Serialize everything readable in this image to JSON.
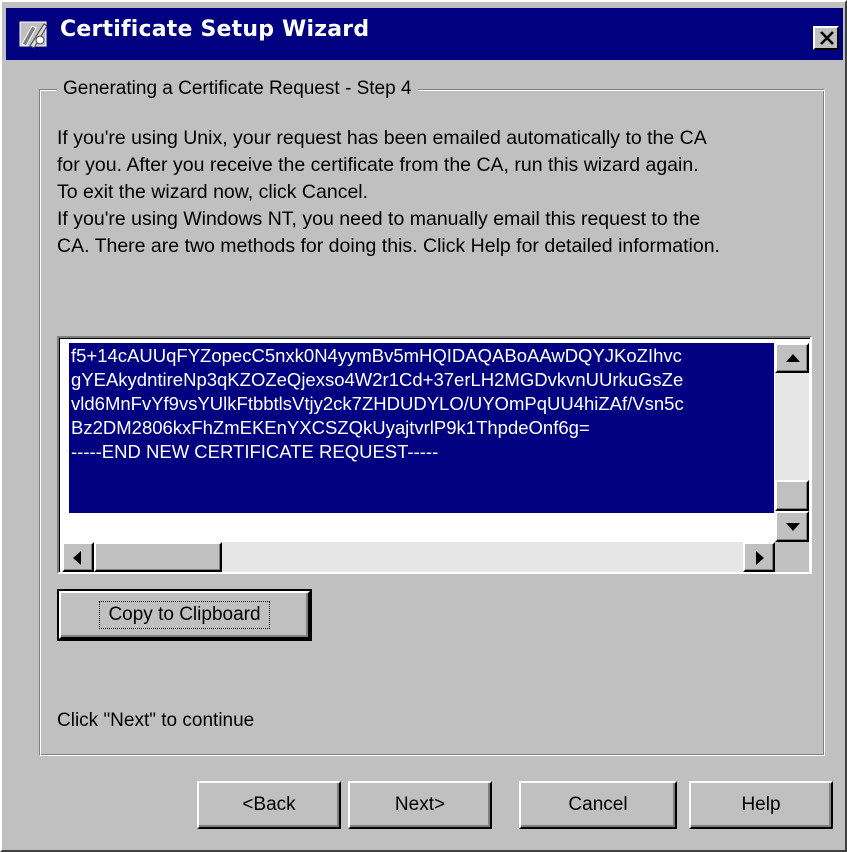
{
  "window": {
    "title": "Certificate Setup Wizard",
    "title_icon": "certificate-wizard-icon",
    "close_icon": "close-icon",
    "titlebar_color": "#000080",
    "face_color": "#c0c0c0"
  },
  "group": {
    "title": "Generating a Certificate Request - Step 4",
    "description_lines": [
      "If you're using Unix, your request has been emailed  automatically to the CA",
      "for you.  After you receive the certificate from the CA, run this wizard again.",
      "To exit the wizard now, click Cancel.",
      "If you're using Windows NT, you need to manually email this request to the",
      "CA.  There are two methods for doing this.  Click Help for detailed information."
    ]
  },
  "request_text": {
    "lines": [
      "f5+14cAUUqFYZopecC5nxk0N4yymBv5mHQIDAQABoAAwDQYJKoZIhvc",
      "gYEAkydntireNp3qKZOZeQjexso4W2r1Cd+37erLH2MGDvkvnUUrkuGsZe",
      "vld6MnFvYf9vsYUlkFtbbtlsVtjy2ck7ZHDUDYLO/UYOmPqUU4hiZAf/Vsn5c",
      "Bz2DM2806kxFhZmEKEnYXCSZQkUyajtvrlP9k1ThpdeOnf6g=",
      "-----END NEW CERTIFICATE REQUEST-----"
    ],
    "selection_color": "#000080"
  },
  "buttons": {
    "copy": "Copy to Clipboard",
    "back": "<Back",
    "next": "Next>",
    "cancel": "Cancel",
    "help": "Help"
  },
  "continue_text": "Click \"Next\" to continue"
}
